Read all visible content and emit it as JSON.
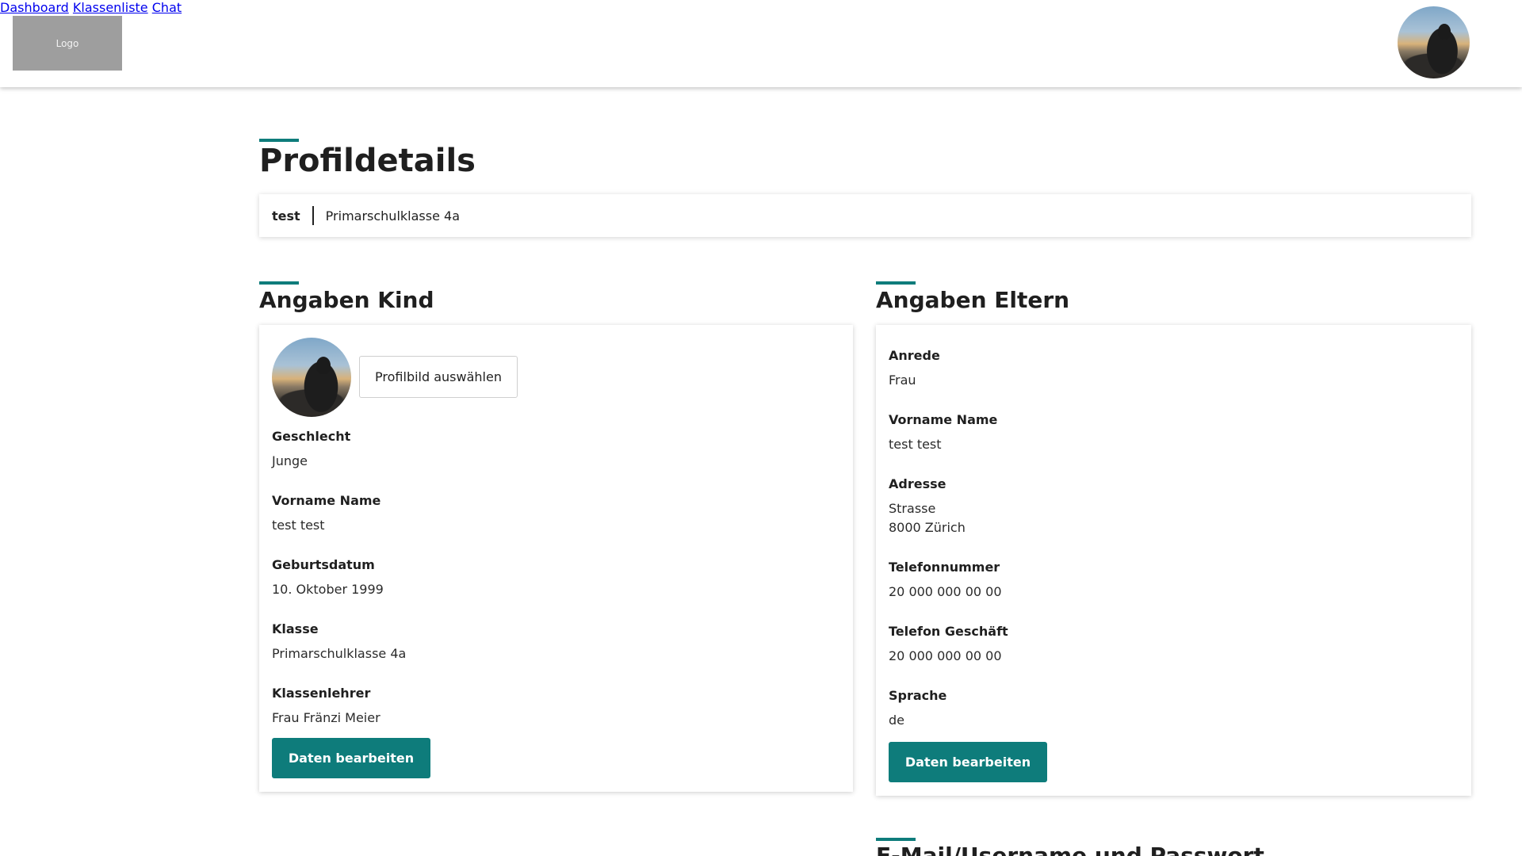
{
  "header": {
    "logo_text": "Logo",
    "nav": [
      "Dashboard",
      "Klassenliste",
      "Chat"
    ]
  },
  "page": {
    "title": "Profildetails",
    "info_name": "test",
    "info_class": "Primarschulklasse 4a"
  },
  "kind": {
    "title": "Angaben Kind",
    "choose_picture_label": "Profilbild auswählen",
    "fields": [
      {
        "label": "Geschlecht",
        "value": "Junge"
      },
      {
        "label": "Vorname Name",
        "value": "test test"
      },
      {
        "label": "Geburtsdatum",
        "value": "10. Oktober 1999"
      },
      {
        "label": "Klasse",
        "value": "Primarschulklasse 4a"
      },
      {
        "label": "Klassenlehrer",
        "value": "Frau Fränzi Meier"
      }
    ],
    "edit_label": "Daten bearbeiten"
  },
  "eltern": {
    "title": "Angaben Eltern",
    "fields": [
      {
        "label": "Anrede",
        "value": "Frau"
      },
      {
        "label": "Vorname Name",
        "value": "test test"
      },
      {
        "label": "Adresse",
        "value": "Strasse",
        "value2": "8000 Zürich"
      },
      {
        "label": "Telefonnummer",
        "value": "20 000 000 00 00"
      },
      {
        "label": "Telefon Geschäft",
        "value": "20 000 000 00 00"
      },
      {
        "label": "Sprache",
        "value": "de"
      }
    ],
    "edit_label": "Daten bearbeiten"
  },
  "account_section_title": "E-Mail/Username und Passwort",
  "colors": {
    "accent": "#0e7c7b"
  }
}
